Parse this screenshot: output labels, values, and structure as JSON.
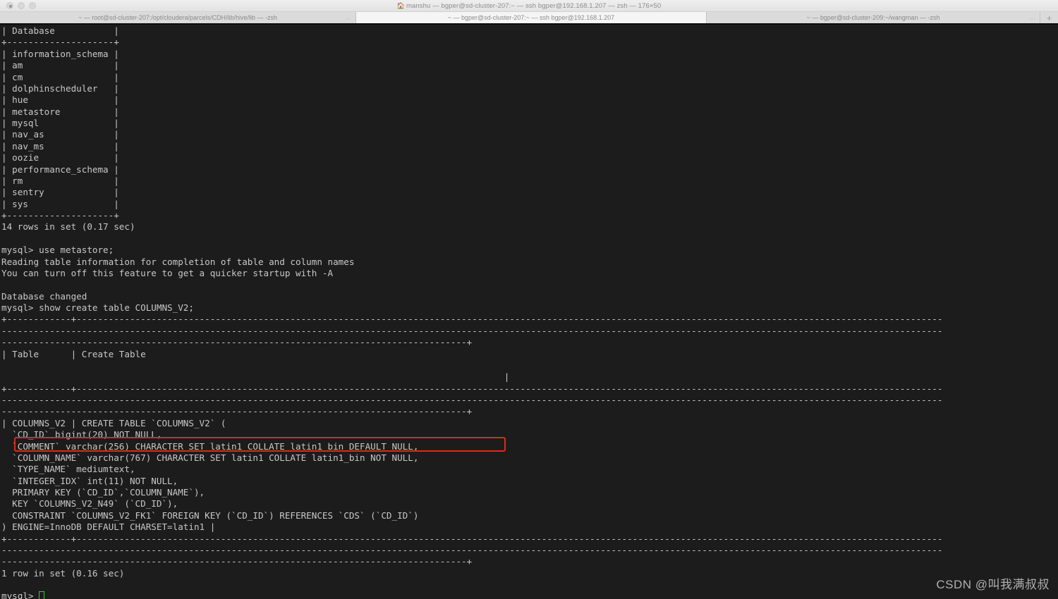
{
  "window": {
    "title": "manshu — bgper@sd-cluster-207:~ — ssh bgper@192.168.1.207 — zsh — 176×50",
    "home_icon": "home-icon",
    "traffic_lights": [
      "close-button",
      "minimize-button",
      "zoom-button"
    ]
  },
  "tabs": [
    {
      "label": "~ — root@sd-cluster-207:/opt/cloudera/parcels/CDH/lib/hive/lib — -zsh",
      "active": false,
      "overflow": "..."
    },
    {
      "label": "~ — bgper@sd-cluster-207:~ — ssh bgper@192.168.1.207",
      "active": true,
      "overflow": ""
    },
    {
      "label": "~ — bgper@sd-cluster-209:~/wangman — -zsh",
      "active": false,
      "overflow": "..."
    }
  ],
  "new_tab_label": "+",
  "terminal": {
    "colors": {
      "background": "#1c1c1c",
      "foreground": "#c8c8c8",
      "cursor": "#3ec63e",
      "highlight": "#d92b20"
    },
    "lines": [
      "| Database           |",
      "+--------------------+",
      "| information_schema |",
      "| am                 |",
      "| cm                 |",
      "| dolphinscheduler   |",
      "| hue                |",
      "| metastore          |",
      "| mysql              |",
      "| nav_as             |",
      "| nav_ms             |",
      "| oozie              |",
      "| performance_schema |",
      "| rm                 |",
      "| sentry             |",
      "| sys                |",
      "+--------------------+",
      "14 rows in set (0.17 sec)",
      "",
      "mysql> use metastore;",
      "Reading table information for completion of table and column names",
      "You can turn off this feature to get a quicker startup with -A",
      "",
      "Database changed",
      "mysql> show create table COLUMNS_V2;",
      "+------------+-----------------------------------------------------------------------------------------------------------------------------------------------------------------------------------------------------------------------------------------------------------------------------------------------------------------------------------------------------------------------------------------------------------------------------------------+",
      "| Table      | Create Table                                                                                                                                                                                                                                                                                                                                                                                                                                   |",
      "+------------+-----------------------------------------------------------------------------------------------------------------------------------------------------------------------------------------------------------------------------------------------------------------------------------------------------------------------------------------------------------------------------------------------------------------------------------------+",
      "| COLUMNS_V2 | CREATE TABLE `COLUMNS_V2` (",
      "  `CD_ID` bigint(20) NOT NULL,",
      "  `COMMENT` varchar(256) CHARACTER SET latin1 COLLATE latin1_bin DEFAULT NULL,",
      "  `COLUMN_NAME` varchar(767) CHARACTER SET latin1 COLLATE latin1_bin NOT NULL,",
      "  `TYPE_NAME` mediumtext,",
      "  `INTEGER_IDX` int(11) NOT NULL,",
      "  PRIMARY KEY (`CD_ID`,`COLUMN_NAME`),",
      "  KEY `COLUMNS_V2_N49` (`CD_ID`),",
      "  CONSTRAINT `COLUMNS_V2_FK1` FOREIGN KEY (`CD_ID`) REFERENCES `CDS` (`CD_ID`)",
      ") ENGINE=InnoDB DEFAULT CHARSET=latin1 |",
      "+------------+-----------------------------------------------------------------------------------------------------------------------------------------------------------------------------------------------------------------------------------------------------------------------------------------------------------------------------------------------------------------------------------------------------------------------------------------+",
      "1 row in set (0.16 sec)",
      "",
      "mysql> "
    ],
    "highlighted_line": "  `COMMENT` varchar(256) CHARACTER SET latin1 COLLATE latin1_bin DEFAULT NULL,",
    "prompt": "mysql> ",
    "cursor_label": "text-cursor"
  },
  "watermark": {
    "text": "CSDN @叫我满叔叔"
  }
}
